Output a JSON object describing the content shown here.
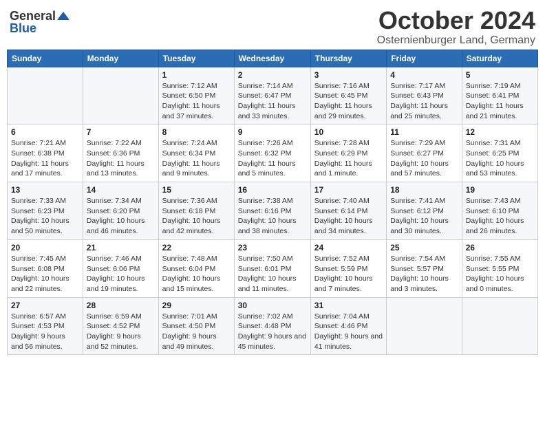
{
  "header": {
    "logo_general": "General",
    "logo_blue": "Blue",
    "title": "October 2024",
    "subtitle": "Osternienburger Land, Germany"
  },
  "calendar": {
    "weekdays": [
      "Sunday",
      "Monday",
      "Tuesday",
      "Wednesday",
      "Thursday",
      "Friday",
      "Saturday"
    ],
    "weeks": [
      [
        {
          "day": "",
          "info": ""
        },
        {
          "day": "",
          "info": ""
        },
        {
          "day": "1",
          "info": "Sunrise: 7:12 AM\nSunset: 6:50 PM\nDaylight: 11 hours and 37 minutes."
        },
        {
          "day": "2",
          "info": "Sunrise: 7:14 AM\nSunset: 6:47 PM\nDaylight: 11 hours and 33 minutes."
        },
        {
          "day": "3",
          "info": "Sunrise: 7:16 AM\nSunset: 6:45 PM\nDaylight: 11 hours and 29 minutes."
        },
        {
          "day": "4",
          "info": "Sunrise: 7:17 AM\nSunset: 6:43 PM\nDaylight: 11 hours and 25 minutes."
        },
        {
          "day": "5",
          "info": "Sunrise: 7:19 AM\nSunset: 6:41 PM\nDaylight: 11 hours and 21 minutes."
        }
      ],
      [
        {
          "day": "6",
          "info": "Sunrise: 7:21 AM\nSunset: 6:38 PM\nDaylight: 11 hours and 17 minutes."
        },
        {
          "day": "7",
          "info": "Sunrise: 7:22 AM\nSunset: 6:36 PM\nDaylight: 11 hours and 13 minutes."
        },
        {
          "day": "8",
          "info": "Sunrise: 7:24 AM\nSunset: 6:34 PM\nDaylight: 11 hours and 9 minutes."
        },
        {
          "day": "9",
          "info": "Sunrise: 7:26 AM\nSunset: 6:32 PM\nDaylight: 11 hours and 5 minutes."
        },
        {
          "day": "10",
          "info": "Sunrise: 7:28 AM\nSunset: 6:29 PM\nDaylight: 11 hours and 1 minute."
        },
        {
          "day": "11",
          "info": "Sunrise: 7:29 AM\nSunset: 6:27 PM\nDaylight: 10 hours and 57 minutes."
        },
        {
          "day": "12",
          "info": "Sunrise: 7:31 AM\nSunset: 6:25 PM\nDaylight: 10 hours and 53 minutes."
        }
      ],
      [
        {
          "day": "13",
          "info": "Sunrise: 7:33 AM\nSunset: 6:23 PM\nDaylight: 10 hours and 50 minutes."
        },
        {
          "day": "14",
          "info": "Sunrise: 7:34 AM\nSunset: 6:20 PM\nDaylight: 10 hours and 46 minutes."
        },
        {
          "day": "15",
          "info": "Sunrise: 7:36 AM\nSunset: 6:18 PM\nDaylight: 10 hours and 42 minutes."
        },
        {
          "day": "16",
          "info": "Sunrise: 7:38 AM\nSunset: 6:16 PM\nDaylight: 10 hours and 38 minutes."
        },
        {
          "day": "17",
          "info": "Sunrise: 7:40 AM\nSunset: 6:14 PM\nDaylight: 10 hours and 34 minutes."
        },
        {
          "day": "18",
          "info": "Sunrise: 7:41 AM\nSunset: 6:12 PM\nDaylight: 10 hours and 30 minutes."
        },
        {
          "day": "19",
          "info": "Sunrise: 7:43 AM\nSunset: 6:10 PM\nDaylight: 10 hours and 26 minutes."
        }
      ],
      [
        {
          "day": "20",
          "info": "Sunrise: 7:45 AM\nSunset: 6:08 PM\nDaylight: 10 hours and 22 minutes."
        },
        {
          "day": "21",
          "info": "Sunrise: 7:46 AM\nSunset: 6:06 PM\nDaylight: 10 hours and 19 minutes."
        },
        {
          "day": "22",
          "info": "Sunrise: 7:48 AM\nSunset: 6:04 PM\nDaylight: 10 hours and 15 minutes."
        },
        {
          "day": "23",
          "info": "Sunrise: 7:50 AM\nSunset: 6:01 PM\nDaylight: 10 hours and 11 minutes."
        },
        {
          "day": "24",
          "info": "Sunrise: 7:52 AM\nSunset: 5:59 PM\nDaylight: 10 hours and 7 minutes."
        },
        {
          "day": "25",
          "info": "Sunrise: 7:54 AM\nSunset: 5:57 PM\nDaylight: 10 hours and 3 minutes."
        },
        {
          "day": "26",
          "info": "Sunrise: 7:55 AM\nSunset: 5:55 PM\nDaylight: 10 hours and 0 minutes."
        }
      ],
      [
        {
          "day": "27",
          "info": "Sunrise: 6:57 AM\nSunset: 4:53 PM\nDaylight: 9 hours and 56 minutes."
        },
        {
          "day": "28",
          "info": "Sunrise: 6:59 AM\nSunset: 4:52 PM\nDaylight: 9 hours and 52 minutes."
        },
        {
          "day": "29",
          "info": "Sunrise: 7:01 AM\nSunset: 4:50 PM\nDaylight: 9 hours and 49 minutes."
        },
        {
          "day": "30",
          "info": "Sunrise: 7:02 AM\nSunset: 4:48 PM\nDaylight: 9 hours and 45 minutes."
        },
        {
          "day": "31",
          "info": "Sunrise: 7:04 AM\nSunset: 4:46 PM\nDaylight: 9 hours and 41 minutes."
        },
        {
          "day": "",
          "info": ""
        },
        {
          "day": "",
          "info": ""
        }
      ]
    ]
  }
}
